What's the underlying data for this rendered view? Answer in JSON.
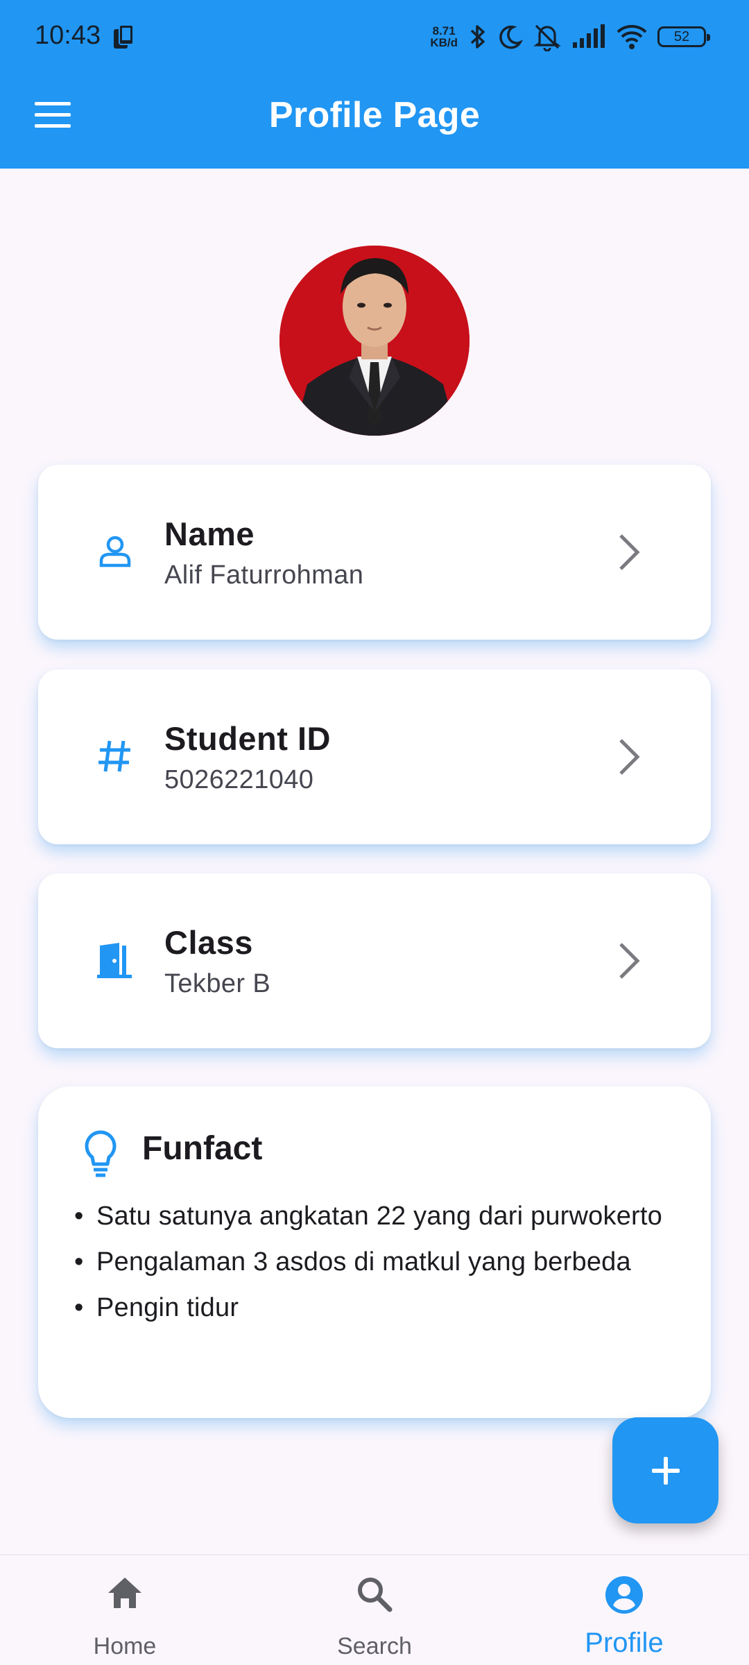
{
  "status_bar": {
    "time": "10:43",
    "net_speed_value": "8.71",
    "net_speed_unit": "KB/d",
    "battery": "52"
  },
  "app_bar": {
    "title": "Profile Page"
  },
  "cards": [
    {
      "icon": "person-icon",
      "title": "Name",
      "subtitle": "Alif Faturrohman"
    },
    {
      "icon": "hash-icon",
      "title": "Student ID",
      "subtitle": "5026221040"
    },
    {
      "icon": "door-icon",
      "title": "Class",
      "subtitle": "Tekber B"
    }
  ],
  "funfact": {
    "title": "Funfact",
    "items": [
      "Satu satunya angkatan 22 yang dari purwokerto",
      "Pengalaman 3 asdos di matkul yang berbeda",
      "Pengin tidur"
    ]
  },
  "bottom_nav": {
    "items": [
      {
        "label": "Home",
        "icon": "home-icon",
        "active": false
      },
      {
        "label": "Search",
        "icon": "search-icon",
        "active": false
      },
      {
        "label": "Profile",
        "icon": "account-circle-icon",
        "active": true
      }
    ]
  },
  "colors": {
    "primary": "#2196f3",
    "background": "#fbf6fc",
    "card": "#ffffff",
    "inactive": "#5f5f66"
  }
}
